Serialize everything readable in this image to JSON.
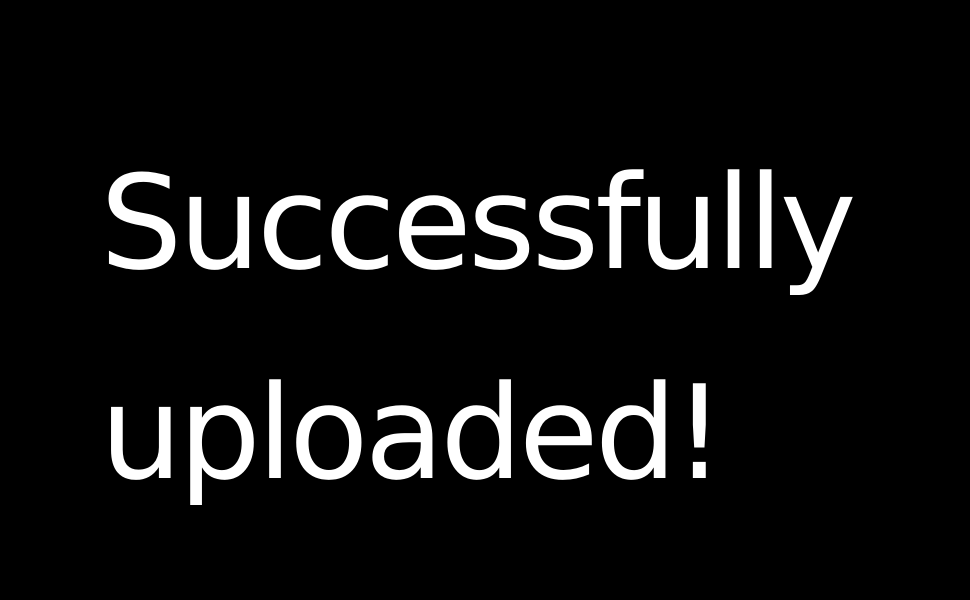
{
  "message": {
    "line1": "Successfully",
    "line2": "uploaded!"
  },
  "colors": {
    "background": "#000000",
    "text": "#ffffff"
  }
}
